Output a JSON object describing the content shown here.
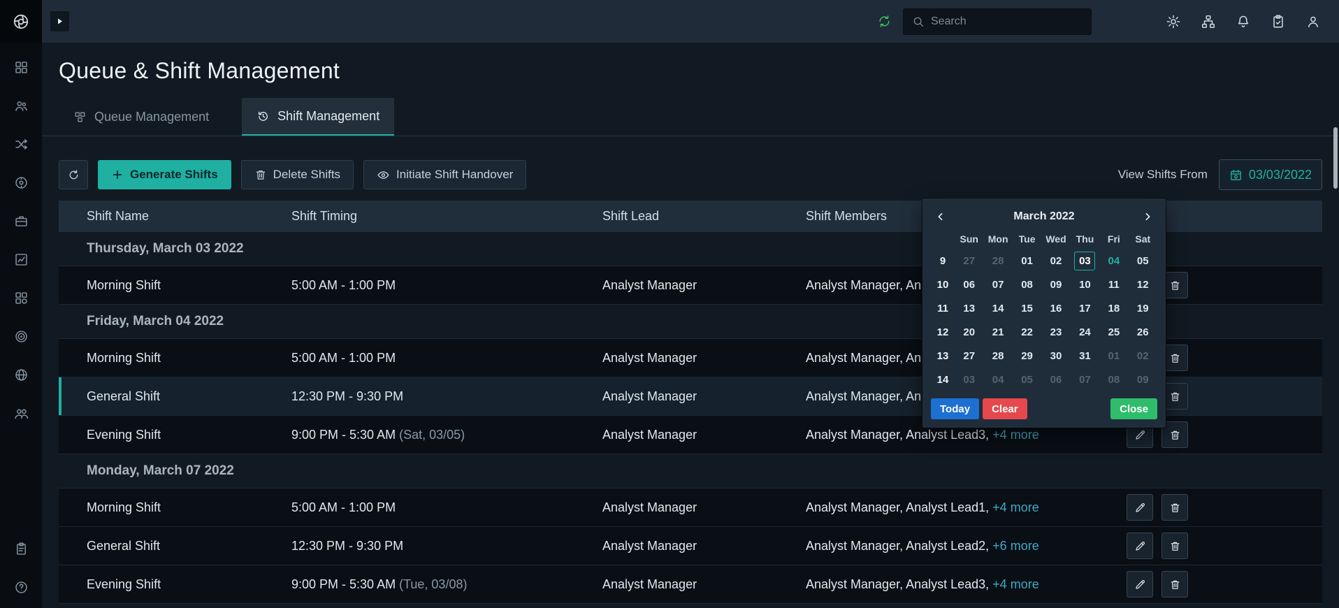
{
  "colors": {
    "accent": "#1fb0a2",
    "link": "#3fa9c6",
    "blue": "#1d6fd2",
    "red": "#e5484d",
    "green": "#2fbd6b"
  },
  "topbar": {
    "search_placeholder": "Search"
  },
  "page": {
    "title": "Queue & Shift Management"
  },
  "tabs": [
    {
      "label": "Queue Management",
      "active": false
    },
    {
      "label": "Shift Management",
      "active": true
    }
  ],
  "toolbar": {
    "generate_label": "Generate Shifts",
    "delete_label": "Delete Shifts",
    "handover_label": "Initiate Shift Handover",
    "view_shifts_label": "View Shifts From",
    "date_value": "03/03/2022"
  },
  "sidebar": {
    "items": [
      {
        "icon": "grid"
      },
      {
        "icon": "users"
      },
      {
        "icon": "shuffle"
      },
      {
        "icon": "disc"
      },
      {
        "icon": "briefcase"
      },
      {
        "icon": "chart"
      },
      {
        "icon": "blocks"
      },
      {
        "icon": "bullseye"
      },
      {
        "icon": "globe"
      },
      {
        "icon": "people"
      }
    ],
    "bottom_items": [
      {
        "icon": "clipboard"
      },
      {
        "icon": "globeq"
      }
    ]
  },
  "table": {
    "columns": [
      "Shift Name",
      "Shift Timing",
      "Shift Lead",
      "Shift Members"
    ],
    "groups": [
      {
        "label": "Thursday, March 03 2022",
        "rows": [
          {
            "name": "Morning Shift",
            "timing": "5:00 AM - 1:00 PM",
            "timing_note": "",
            "lead": "Analyst Manager",
            "members": "Analyst Manager, Ana",
            "more": "",
            "selected": false
          }
        ]
      },
      {
        "label": "Friday, March 04 2022",
        "rows": [
          {
            "name": "Morning Shift",
            "timing": "5:00 AM - 1:00 PM",
            "timing_note": "",
            "lead": "Analyst Manager",
            "members": "Analyst Manager, Ana",
            "more": "",
            "selected": false
          },
          {
            "name": "General Shift",
            "timing": "12:30 PM - 9:30 PM",
            "timing_note": "",
            "lead": "Analyst Manager",
            "members": "Analyst Manager, Ana",
            "more": "",
            "selected": true
          },
          {
            "name": "Evening Shift",
            "timing": "9:00 PM - 5:30 AM",
            "timing_note": "(Sat, 03/05)",
            "lead": "Analyst Manager",
            "members": "Analyst Manager, Analyst Lead3,",
            "more": "+4 more",
            "selected": false
          }
        ]
      },
      {
        "label": "Monday, March 07 2022",
        "rows": [
          {
            "name": "Morning Shift",
            "timing": "5:00 AM - 1:00 PM",
            "timing_note": "",
            "lead": "Analyst Manager",
            "members": "Analyst Manager, Analyst Lead1,",
            "more": "+4 more",
            "selected": false
          },
          {
            "name": "General Shift",
            "timing": "12:30 PM - 9:30 PM",
            "timing_note": "",
            "lead": "Analyst Manager",
            "members": "Analyst Manager, Analyst Lead2,",
            "more": "+6 more",
            "selected": false
          },
          {
            "name": "Evening Shift",
            "timing": "9:00 PM - 5:30 AM",
            "timing_note": "(Tue, 03/08)",
            "lead": "Analyst Manager",
            "members": "Analyst Manager, Analyst Lead3,",
            "more": "+4 more",
            "selected": false
          }
        ]
      }
    ]
  },
  "datepicker": {
    "month_label": "March 2022",
    "weekdays": [
      "Sun",
      "Mon",
      "Tue",
      "Wed",
      "Thu",
      "Fri",
      "Sat"
    ],
    "weeks": [
      {
        "num": "9",
        "days": [
          {
            "d": "27",
            "muted": true
          },
          {
            "d": "28",
            "muted": true
          },
          {
            "d": "01"
          },
          {
            "d": "02"
          },
          {
            "d": "03",
            "selected": true
          },
          {
            "d": "04",
            "today": true
          },
          {
            "d": "05"
          }
        ]
      },
      {
        "num": "10",
        "days": [
          {
            "d": "06"
          },
          {
            "d": "07"
          },
          {
            "d": "08"
          },
          {
            "d": "09"
          },
          {
            "d": "10"
          },
          {
            "d": "11"
          },
          {
            "d": "12"
          }
        ]
      },
      {
        "num": "11",
        "days": [
          {
            "d": "13"
          },
          {
            "d": "14"
          },
          {
            "d": "15"
          },
          {
            "d": "16"
          },
          {
            "d": "17"
          },
          {
            "d": "18"
          },
          {
            "d": "19"
          }
        ]
      },
      {
        "num": "12",
        "days": [
          {
            "d": "20"
          },
          {
            "d": "21"
          },
          {
            "d": "22"
          },
          {
            "d": "23"
          },
          {
            "d": "24"
          },
          {
            "d": "25"
          },
          {
            "d": "26"
          }
        ]
      },
      {
        "num": "13",
        "days": [
          {
            "d": "27"
          },
          {
            "d": "28"
          },
          {
            "d": "29"
          },
          {
            "d": "30"
          },
          {
            "d": "31"
          },
          {
            "d": "01",
            "muted": true
          },
          {
            "d": "02",
            "muted": true
          }
        ]
      },
      {
        "num": "14",
        "days": [
          {
            "d": "03",
            "muted": true
          },
          {
            "d": "04",
            "muted": true
          },
          {
            "d": "05",
            "muted": true
          },
          {
            "d": "06",
            "muted": true
          },
          {
            "d": "07",
            "muted": true
          },
          {
            "d": "08",
            "muted": true
          },
          {
            "d": "09",
            "muted": true
          }
        ]
      }
    ],
    "buttons": {
      "today": "Today",
      "clear": "Clear",
      "close": "Close"
    }
  }
}
